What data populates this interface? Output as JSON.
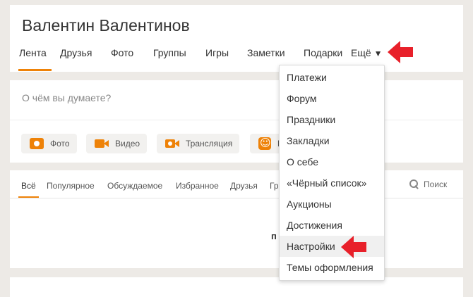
{
  "profile": {
    "name": "Валентин Валентинов",
    "tabs": [
      "Лента",
      "Друзья",
      "Фото",
      "Группы",
      "Игры",
      "Заметки",
      "Подарки"
    ],
    "more_label": "Ещё",
    "more_caret": "▼"
  },
  "composer": {
    "placeholder": "О чём вы думаете?",
    "buttons": [
      "Фото",
      "Видео",
      "Трансляция",
      "Н"
    ]
  },
  "feed": {
    "filters": [
      "Всё",
      "Популярное",
      "Обсуждаемое",
      "Избранное",
      "Друзья",
      "Гр"
    ],
    "search_label": "Поиск",
    "content_fragment": "п"
  },
  "dropdown": {
    "items": [
      "Платежи",
      "Форум",
      "Праздники",
      "Закладки",
      "О себе",
      "«Чёрный список»",
      "Аукционы",
      "Достижения",
      "Настройки",
      "Темы оформления"
    ],
    "highlighted_index": 8
  },
  "colors": {
    "accent": "#ee8208",
    "annotation_arrow": "#e8202a"
  }
}
